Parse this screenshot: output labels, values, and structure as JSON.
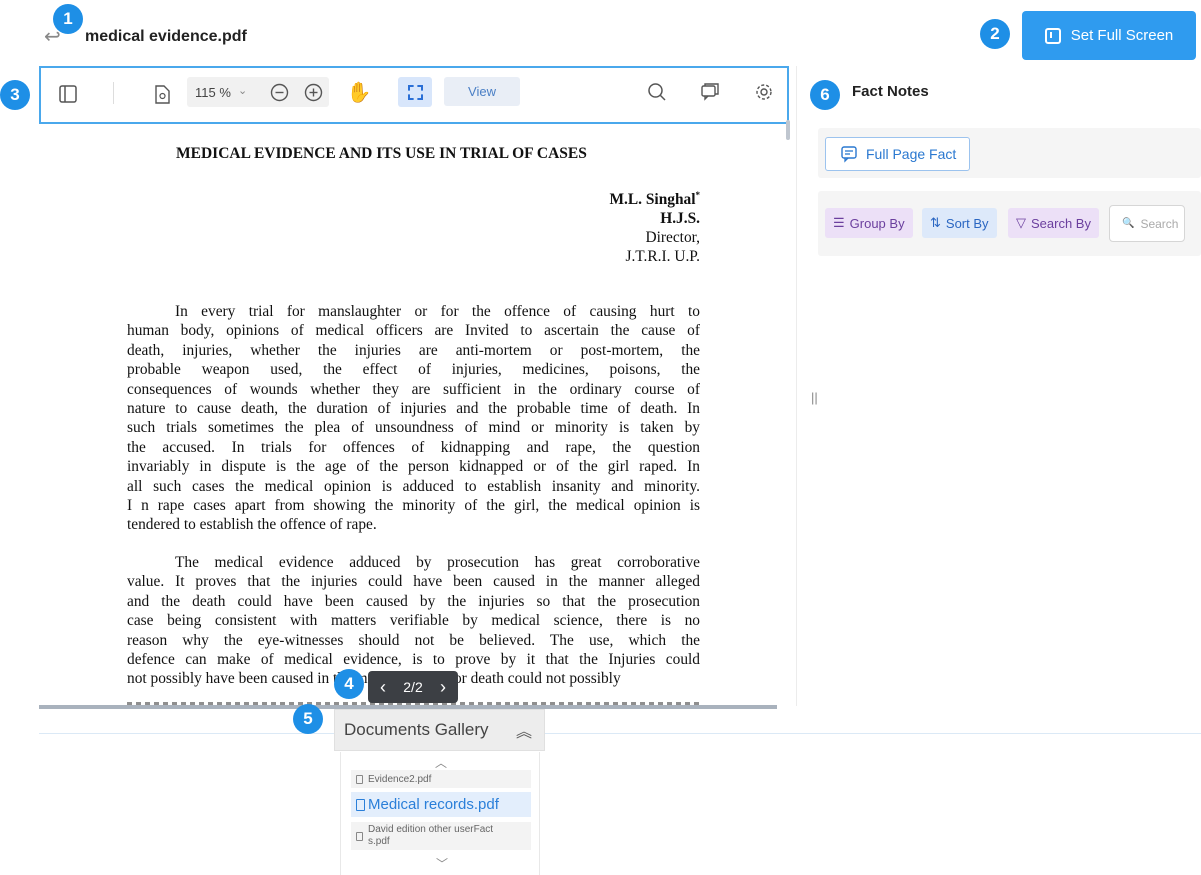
{
  "header": {
    "back_icon": "back-arrow-icon",
    "file_title": "medical evidence.pdf",
    "fullscreen_label": "Set Full Screen"
  },
  "badges": [
    "1",
    "2",
    "3",
    "4",
    "5",
    "6"
  ],
  "toolbar": {
    "zoom": "115 %",
    "view_label": "View",
    "icons": [
      "sidebar-toggle-icon",
      "page-icon",
      "zoom-out-icon",
      "zoom-in-icon",
      "hand-icon",
      "area-select-icon",
      "search-icon",
      "comment-icon",
      "settings-icon"
    ]
  },
  "document": {
    "heading": "MEDICAL EVIDENCE AND ITS USE IN TRIAL OF CASES",
    "author_name": "M.L. Singhal",
    "author_mark": "*",
    "author_title": "H.J.S.",
    "author_role": "Director,",
    "author_org": "J.T.R.I. U.P.",
    "para1_lines": [
      "In every trial for manslaughter or for the offence of causing hurt to",
      "human body, opinions of medical officers are Invited to ascertain the cause of",
      "death, injuries, whether the injuries are anti-mortem or post-mortem, the",
      "probable weapon used, the effect of injuries, medicines, poisons, the",
      "consequences of wounds whether they are sufficient in the ordinary course of",
      "nature to cause death, the duration of injuries and the probable time of death. In",
      "such trials sometimes the plea of unsoundness of mind or minority is taken by",
      "the accused. In trials for offences of kidnapping and rape, the question",
      "invariably in dispute is the age of the person kidnapped or of the girl raped. In",
      "all such cases the medical opinion is adduced to establish insanity and minority.",
      "I n rape cases apart from showing the minority of the girl, the medical opinion is",
      "tendered to establish the offence of rape."
    ],
    "para2_lines": [
      "The medical evidence adduced by prosecution has great corroborative",
      "value. It proves that the injuries could have been caused in the manner alleged",
      "and the death could have been caused by the injuries so that the prosecution",
      "case being consistent with matters verifiable by medical science, there is no",
      "reason why the eye-witnesses should not be believed. The use, which the",
      "defence can make of medical evidence, is to prove by it that the Injuries could",
      "not possibly have been caused in the manner alleged or death could not possibly"
    ]
  },
  "pager": {
    "prev": "‹",
    "page": "2/2",
    "next": "›"
  },
  "gallery": {
    "title": "Documents Gallery",
    "items": [
      {
        "name": "Evidence2.pdf",
        "active": false
      },
      {
        "name": "Medical records.pdf",
        "active": true
      },
      {
        "name": "David edition other userFacts.pdf",
        "active": false
      }
    ]
  },
  "fact_notes": {
    "title": "Fact Notes",
    "full_page_fact": "Full Page Fact",
    "group_by": "Group By",
    "sort_by": "Sort By",
    "search_by": "Search By",
    "search_placeholder": "Search"
  },
  "colors": {
    "accent": "#2f9bef",
    "badge": "#1e8fe6",
    "toolbar_border": "#4aa8ec"
  }
}
